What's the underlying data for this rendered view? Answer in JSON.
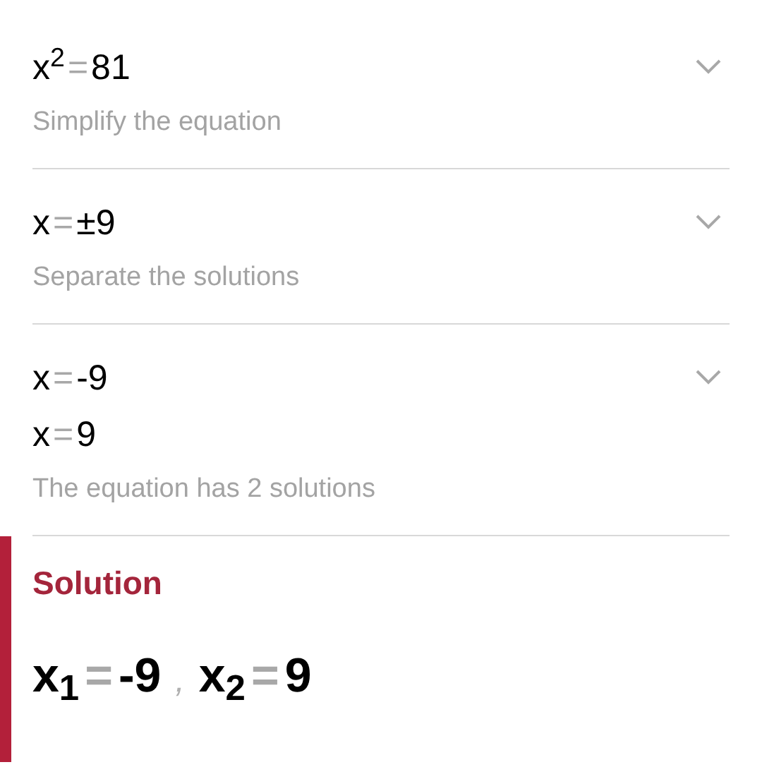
{
  "steps": [
    {
      "equations": [
        {
          "lhs": "x$^{2}$",
          "op": "=",
          "rhs": "81"
        }
      ],
      "description": "Simplify the equation",
      "expanded": false
    },
    {
      "equations": [
        {
          "lhs": "x",
          "op": "=",
          "rhs": "±9"
        }
      ],
      "description": "Separate the solutions",
      "expanded": false
    },
    {
      "equations": [
        {
          "lhs": "x",
          "op": "=",
          "rhs": "-9"
        },
        {
          "lhs": "x",
          "op": "=",
          "rhs": "9"
        }
      ],
      "description": "The equation has 2 solutions",
      "expanded": false
    }
  ],
  "solution": {
    "title": "Solution",
    "separator": ",",
    "answers": [
      {
        "lhs": "x$_{1}$",
        "op": "=",
        "rhs": "-9"
      },
      {
        "lhs": "x$_{2}$",
        "op": "=",
        "rhs": "9"
      }
    ]
  }
}
